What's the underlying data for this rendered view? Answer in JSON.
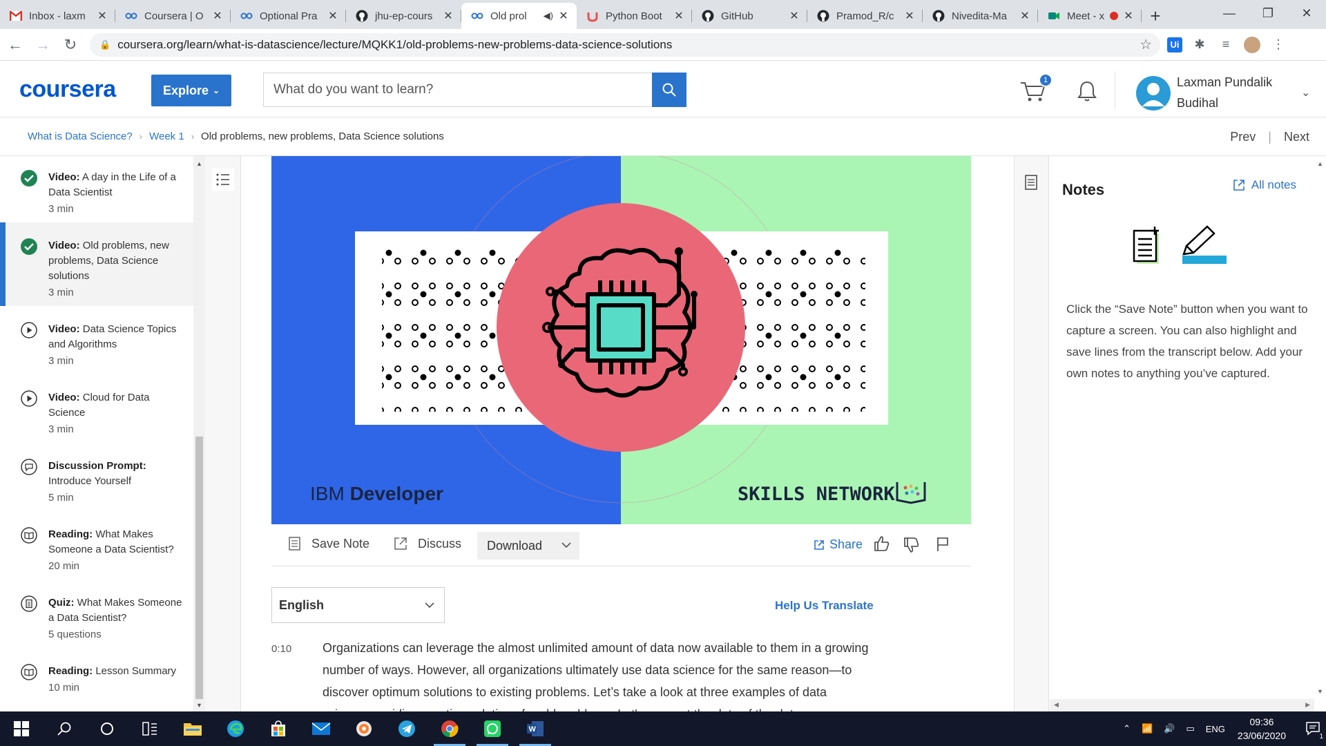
{
  "browser": {
    "tabs": [
      {
        "title": "Inbox - laxm",
        "icon": "gmail-icon",
        "active": false
      },
      {
        "title": "Coursera | O",
        "icon": "coursera-icon",
        "active": false
      },
      {
        "title": "Optional Pra",
        "icon": "coursera-icon",
        "active": false
      },
      {
        "title": "jhu-ep-cours",
        "icon": "github-icon",
        "active": false
      },
      {
        "title": "Old prol",
        "icon": "coursera-icon",
        "active": true
      },
      {
        "title": "Python Boot",
        "icon": "udemy-icon",
        "active": false
      },
      {
        "title": "GitHub",
        "icon": "github-icon",
        "active": false
      },
      {
        "title": "Pramod_R/c",
        "icon": "github-icon",
        "active": false
      },
      {
        "title": "Nivedita-Ma",
        "icon": "github-icon",
        "active": false
      },
      {
        "title": "Meet - x",
        "icon": "meet-icon",
        "active": false
      }
    ],
    "url": "coursera.org/learn/what-is-datascience/lecture/MQKK1/old-problems-new-problems-data-science-solutions"
  },
  "header": {
    "logo": "coursera",
    "explore_label": "Explore",
    "search_placeholder": "What do you want to learn?",
    "cart_count": "1",
    "user_name": "Laxman Pundalik Budihal"
  },
  "breadcrumb": {
    "items": [
      "What is Data Science?",
      "Week 1"
    ],
    "current": "Old problems, new problems, Data Science solutions",
    "prev": "Prev",
    "next": "Next"
  },
  "sidebar": {
    "items": [
      {
        "kind": "Video:",
        "title": "A day in the Life of a Data Scientist",
        "duration": "3 min",
        "status": "completed",
        "selected": false
      },
      {
        "kind": "Video:",
        "title": "Old problems, new problems, Data Science solutions",
        "duration": "3 min",
        "status": "completed",
        "selected": true
      },
      {
        "kind": "Video:",
        "title": "Data Science Topics and Algorithms",
        "duration": "3 min",
        "status": "video",
        "selected": false
      },
      {
        "kind": "Video:",
        "title": "Cloud for Data Science",
        "duration": "3 min",
        "status": "video",
        "selected": false
      },
      {
        "kind": "Discussion Prompt:",
        "title": "Introduce Yourself",
        "duration": "5 min",
        "status": "discussion",
        "selected": false
      },
      {
        "kind": "Reading:",
        "title": "What Makes Someone a Data Scientist?",
        "duration": "20 min",
        "status": "reading",
        "selected": false
      },
      {
        "kind": "Quiz:",
        "title": "What Makes Someone a Data Scientist?",
        "duration": "5 questions",
        "status": "quiz",
        "selected": false
      },
      {
        "kind": "Reading:",
        "title": "Lesson Summary",
        "duration": "10 min",
        "status": "reading",
        "selected": false
      }
    ]
  },
  "video": {
    "left_brand_prefix": "IBM",
    "left_brand_suffix": "Developer",
    "right_brand": "SKILLS NETWORK",
    "colors": {
      "left_bg": "#2f66e7",
      "right_bg": "#abf5b4",
      "circle": "#ea6778",
      "chip": "#56dcc7"
    }
  },
  "toolbar": {
    "save_note": "Save Note",
    "discuss": "Discuss",
    "download": "Download",
    "share": "Share"
  },
  "transcript": {
    "language": "English",
    "help_translate": "Help Us Translate",
    "timestamp": "0:10",
    "text": "Organizations can leverage the almost unlimited amount of data now available to them in a growing number of ways. However, all organizations ultimately use data science for the same reason—to discover optimum solutions to existing problems. Let’s take a look at three examples of data science providing creative solutions for old problems. Let's connect the dots of the data."
  },
  "notes": {
    "title": "Notes",
    "all_notes": "All notes",
    "description": "Click the “Save Note” button when you want to capture a screen. You can also highlight and save lines from the transcript below. Add your own notes to anything you’ve captured."
  },
  "taskbar": {
    "language": "ENG",
    "time": "09:36",
    "date": "23/06/2020",
    "notification_count": "1"
  }
}
